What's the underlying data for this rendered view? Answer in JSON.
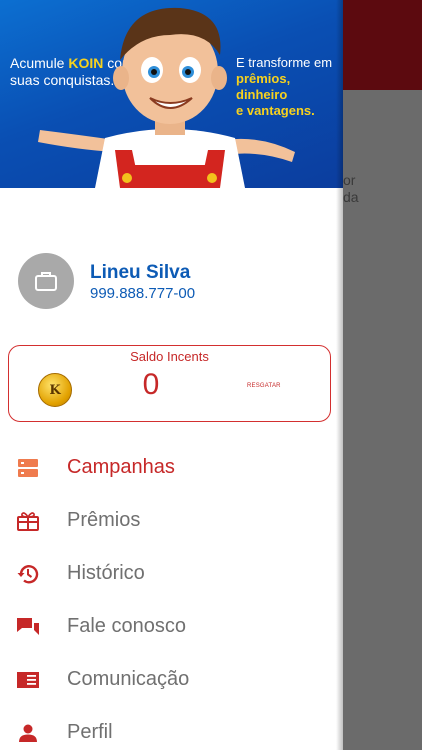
{
  "background": {
    "partial_text_lines": [
      "or",
      "da"
    ]
  },
  "banner": {
    "left_line1_pre": "Acumule ",
    "left_brand": "KOIN",
    "left_line1_post": " com",
    "left_line2": "suas conquistas.",
    "right_line1": "E transforme em",
    "right_highlight1": "prêmios, dinheiro",
    "right_highlight2": "e vantagens."
  },
  "profile": {
    "name": "Lineu Silva",
    "document": "999.888.777-00",
    "avatar_icon": "briefcase-icon"
  },
  "saldo": {
    "title": "Saldo Incents",
    "coin_letter": "K",
    "value": "0",
    "action": "RESGATAR"
  },
  "menu": [
    {
      "label": "Campanhas",
      "icon": "campaigns-icon",
      "active": true
    },
    {
      "label": "Prêmios",
      "icon": "gift-icon",
      "active": false
    },
    {
      "label": "Histórico",
      "icon": "history-icon",
      "active": false
    },
    {
      "label": "Fale conosco",
      "icon": "chat-icon",
      "active": false
    },
    {
      "label": "Comunicação",
      "icon": "newspaper-icon",
      "active": false
    },
    {
      "label": "Perfil",
      "icon": "person-icon",
      "active": false
    }
  ],
  "colors": {
    "accent_red": "#c62828",
    "brand_blue": "#0d5bb5",
    "header_dark_red": "#5c0a0f",
    "overlay_gray": "#6b6b6b"
  }
}
